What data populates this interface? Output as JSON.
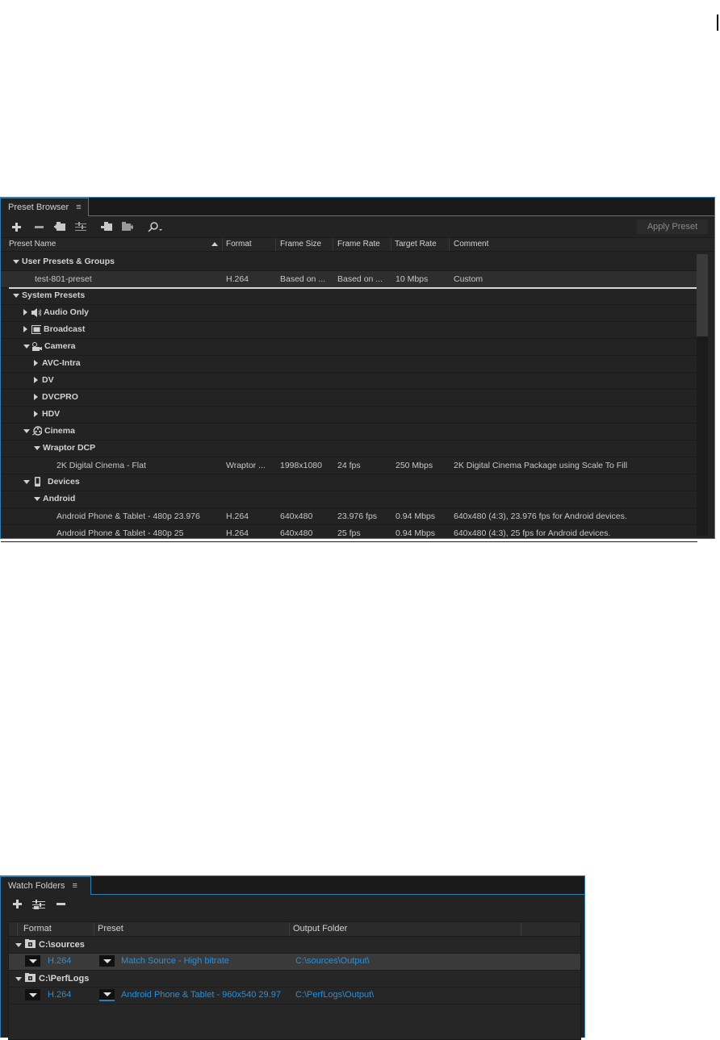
{
  "preset_browser": {
    "tab_label": "Preset Browser",
    "tab_menu_icon": "≡",
    "toolbar": {
      "icons": [
        "plus-icon",
        "minus-icon",
        "new-group-icon",
        "preset-settings-icon",
        "import-preset-icon",
        "export-preset-icon",
        "search-icon"
      ],
      "apply_label": "Apply Preset"
    },
    "columns": [
      "Preset Name",
      "Format",
      "Frame Size",
      "Frame Rate",
      "Target Rate",
      "Comment"
    ],
    "rows": [
      {
        "name": "User Presets & Groups",
        "kind": "group",
        "expanded": true
      },
      {
        "name": "test-801-preset",
        "format": "H.264",
        "frame_size": "Based on ...",
        "frame_rate": "Based on ...",
        "target_rate": "10 Mbps",
        "comment": "Custom",
        "selected": true
      },
      {
        "name": "System Presets",
        "kind": "group",
        "expanded": true
      },
      {
        "name": "Audio Only",
        "kind": "group",
        "icon": "speaker-icon"
      },
      {
        "name": "Broadcast",
        "kind": "group",
        "icon": "tv-icon"
      },
      {
        "name": "Camera",
        "kind": "group",
        "icon": "camera-icon",
        "expanded": true
      },
      {
        "name": "AVC-Intra",
        "kind": "group"
      },
      {
        "name": "DV",
        "kind": "group"
      },
      {
        "name": "DVCPRO",
        "kind": "group"
      },
      {
        "name": "HDV",
        "kind": "group"
      },
      {
        "name": "Cinema",
        "kind": "group",
        "icon": "film-reel-icon",
        "expanded": true
      },
      {
        "name": "Wraptor DCP",
        "kind": "group",
        "expanded": true
      },
      {
        "name": "2K Digital Cinema - Flat",
        "format": "Wraptor ...",
        "frame_size": "1998x1080",
        "frame_rate": "24 fps",
        "target_rate": "250 Mbps",
        "comment": "2K Digital Cinema Package using Scale To Fill"
      },
      {
        "name": "Devices",
        "kind": "group",
        "icon": "phone-icon",
        "expanded": true
      },
      {
        "name": "Android",
        "kind": "group",
        "expanded": true
      },
      {
        "name": "Android Phone & Tablet - 480p 23.976",
        "format": "H.264",
        "frame_size": "640x480",
        "frame_rate": "23.976 fps",
        "target_rate": "0.94 Mbps",
        "comment": "640x480 (4:3), 23.976 fps for Android devices."
      },
      {
        "name": "Android Phone & Tablet - 480p 25",
        "format": "H.264",
        "frame_size": "640x480",
        "frame_rate": "25 fps",
        "target_rate": "0.94 Mbps",
        "comment": "640x480 (4:3), 25 fps for Android devices."
      }
    ]
  },
  "watch_folders": {
    "tab_label": "Watch Folders",
    "tab_menu_icon": "≡",
    "toolbar_icons": [
      "plus-icon",
      "settings-icon",
      "minus-icon"
    ],
    "columns": [
      "Format",
      "Preset",
      "Output Folder"
    ],
    "folders": [
      {
        "path": "C:\\sources",
        "format": "H.264",
        "preset": "Match Source - High bitrate",
        "output": "C:\\sources\\Output\\"
      },
      {
        "path": "C:\\PerfLogs",
        "format": "H.264",
        "preset": "Android Phone & Tablet - 960x540 29.97",
        "output": "C:\\PerfLogs\\Output\\"
      }
    ]
  },
  "colors": {
    "panel_bg": "#232323",
    "accent": "#2f7fb5",
    "link_blue": "#2d8fd6"
  }
}
